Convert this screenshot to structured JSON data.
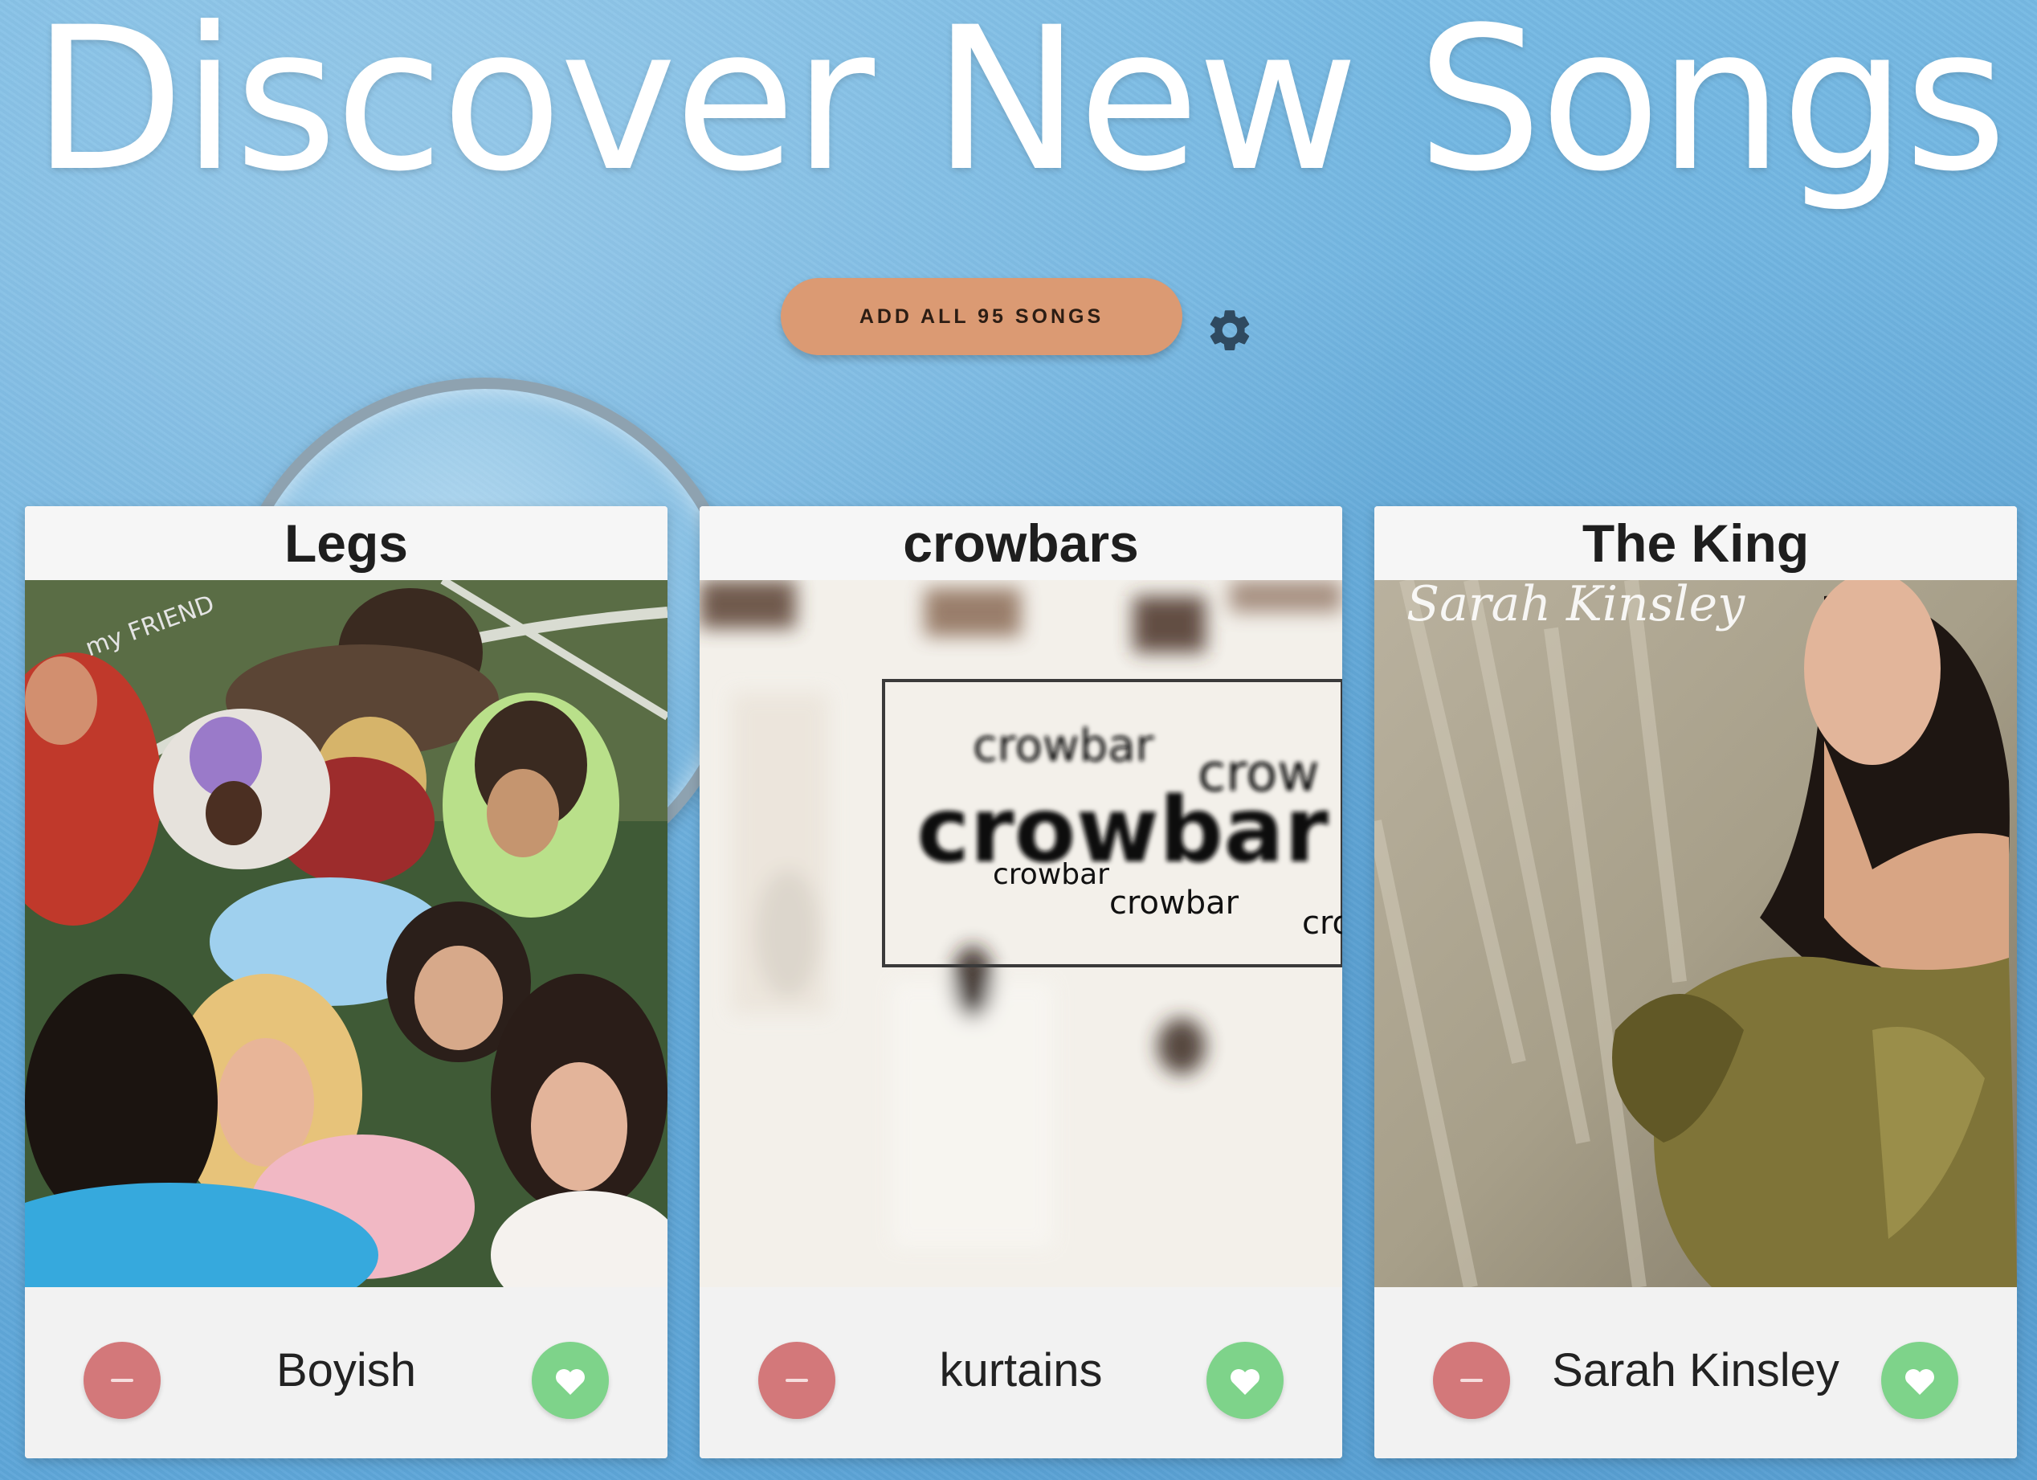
{
  "header": {
    "title": "Discover New Songs"
  },
  "actions": {
    "add_all_label": "ADD ALL 95 SONGS",
    "settings_icon": "gear-icon"
  },
  "colors": {
    "background": "#6fb2df",
    "add_button": "#db9a73",
    "dislike": "#d3787a",
    "like": "#7ed38a",
    "settings_icon": "#2f4a60"
  },
  "cards": [
    {
      "song": "Legs",
      "artist": "Boyish",
      "cover_text": "my FRIEND"
    },
    {
      "song": "crowbars",
      "artist": "kurtains",
      "cover_text": [
        "crowbar",
        "crow",
        "crowbar",
        "crowbar",
        "crowbar",
        "cro"
      ]
    },
    {
      "song": "The King",
      "artist": "Sarah Kinsley",
      "cover_text": "Sarah Kinsley"
    }
  ]
}
